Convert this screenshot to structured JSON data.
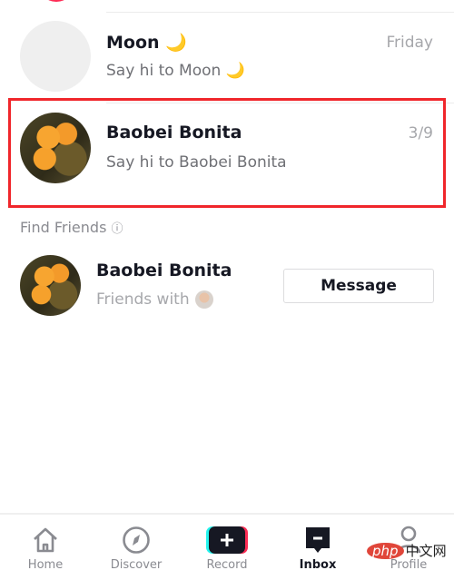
{
  "conversations": [
    {
      "name": "Moon 🌙",
      "preview": "Say hi to Moon 🌙",
      "time": "Friday"
    },
    {
      "name": "Baobei Bonita",
      "preview": "Say hi to Baobei Bonita",
      "time": "3/9",
      "highlighted": true
    }
  ],
  "find_friends": {
    "title": "Find Friends",
    "info_icon": "ⓘ",
    "suggestion": {
      "name": "Baobei Bonita",
      "subtitle": "Friends with",
      "button": "Message"
    }
  },
  "nav": [
    {
      "label": "Home",
      "icon": "home-icon"
    },
    {
      "label": "Discover",
      "icon": "compass-icon"
    },
    {
      "label": "Record",
      "icon": "plus-icon"
    },
    {
      "label": "Inbox",
      "icon": "inbox-icon",
      "active": true
    },
    {
      "label": "Profile",
      "icon": "person-icon"
    }
  ],
  "colors": {
    "highlight": "#f0262b",
    "brand_pink": "#fe2c55",
    "brand_cyan": "#25f4ee"
  },
  "watermark": "php中文网"
}
